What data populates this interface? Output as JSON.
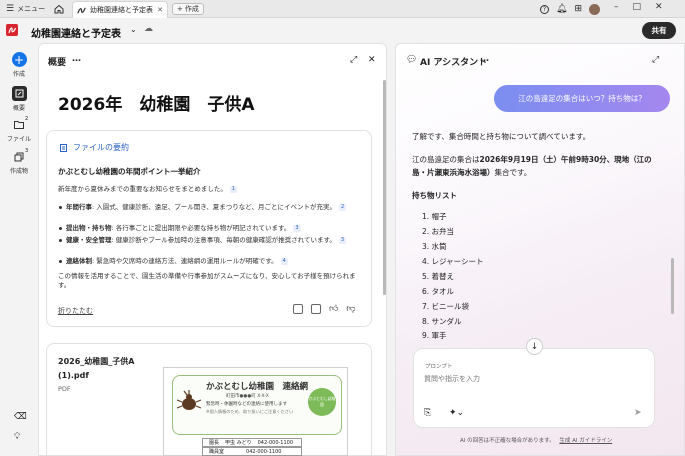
{
  "topbar": {
    "menu_label": "メニュー",
    "tab_title": "幼稚園連絡と予定表",
    "new_tab_label": "作成"
  },
  "header": {
    "doc_title": "幼稚園連絡と予定表",
    "share_label": "共有"
  },
  "rail": {
    "create": "作成",
    "overview": "概要",
    "files": "ファイル",
    "files_badge": "2",
    "works": "作成物",
    "works_badge": "3"
  },
  "overview": {
    "panel_title": "概要",
    "more": "…",
    "doc_heading": "2026年　幼稚園　子供A",
    "summary_label": "ファイルの要約",
    "summary_title": "かぶとむし幼稚園の年間ポイント一挙紹介",
    "intro": "新年度から夏休みまでの重要なお知らせをまとめました。",
    "intro_ref": "1",
    "bullets": [
      {
        "bold": "年間行事",
        "text": ": 入園式、健康診断、遠足、プール開き、夏まつりなど、月ごとにイベントが充実。",
        "ref": "2"
      },
      {
        "bold": "提出物・持ち物",
        "text": ": 各行事ごとに提出期限や必要な持ち物が明記されています。",
        "ref": "3"
      },
      {
        "bold": "健康・安全管理",
        "text": ": 健康診断やプール参加時の注意事項、毎朝の健康確認が推奨されています。",
        "ref": "3"
      },
      {
        "bold": "連絡体制",
        "text": ": 緊急時や欠席時の連絡方法、連絡網の運用ルールが明確です。",
        "ref": "4"
      }
    ],
    "closing": "この情報を活用することで、園生活の準備や行事参加がスムーズになり、安心してお子様を預けられます。",
    "fold": "折りたたむ",
    "file_name_1": "2026_幼稚園_子供A",
    "file_name_2": "(1).pdf",
    "file_type": "PDF",
    "thumb": {
      "title": "かぶとむし幼稚園　連絡網",
      "address": "町田市●●●町 X-X-X",
      "line1": "緊急時・休園時などの連絡に使用します",
      "line2": "※個人情報のため、取り扱いにご注意ください",
      "badge": "かぶとむし幼稚園",
      "row1_a": "園長",
      "row1_b": "甲虫 みどり",
      "row1_c": "042-000-1100",
      "row2_a": "職員室",
      "row2_c": "042-000-1100"
    }
  },
  "assistant": {
    "panel_title": "AI アシスタント",
    "more": "…",
    "user_message": "江の島遠足の集合はいつ？持ち物は？",
    "reply_1": "了解です、集合時間と持ち物について調べています。",
    "reply_2a": "江の島遠足の集合は",
    "reply_2b": "2026年9月19日（土）午前9時30分、現地（江の島・片瀬東浜海水浴場）",
    "reply_2c": "集合です。",
    "list_title": "持ち物リスト",
    "items": [
      "帽子",
      "お弁当",
      "水筒",
      "レジャーシート",
      "着替え",
      "タオル",
      "ビニール袋",
      "サンダル",
      "軍手"
    ],
    "prompt_label": "プロンプト",
    "prompt_placeholder": "質問や指示を入力",
    "disclaimer": "AI の回答は不正確な場合があります。",
    "guidelines_link": "生成 AI ガイドライン"
  },
  "colors": {
    "accent": "#1473e6",
    "pdf_red": "#d7262f",
    "bubble_start": "#7b8ef0",
    "bubble_end": "#a487ef"
  }
}
